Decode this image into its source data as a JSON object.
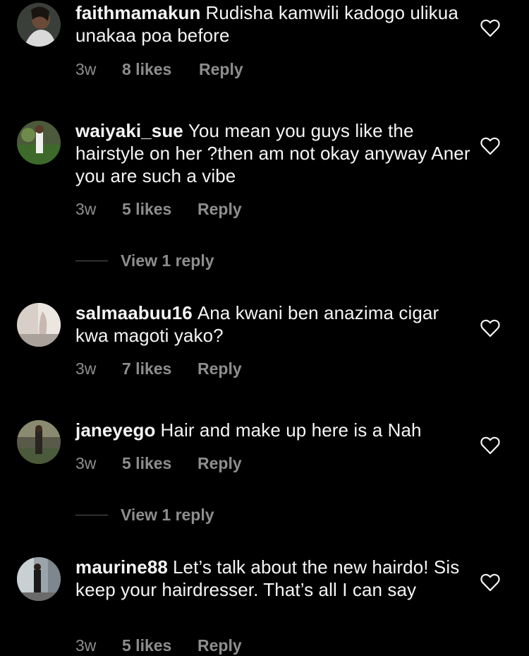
{
  "comments": [
    {
      "username": "faithmamakun",
      "text": "Rudisha kamwili kadogo ulikua unakaa poa before",
      "age": "3w",
      "likes": "8 likes",
      "reply": "Reply",
      "avatar_icon": "profile-photo"
    },
    {
      "username": "waiyaki_sue",
      "text": "You mean you guys like the hairstyle on her ?then am not okay anyway Aner you are such a vibe",
      "age": "3w",
      "likes": "5 likes",
      "reply": "Reply",
      "view_replies": "View 1 reply",
      "avatar_icon": "profile-photo"
    },
    {
      "username": "salmaabuu16",
      "text": "Ana kwani ben anazima cigar kwa magoti yako?",
      "age": "3w",
      "likes": "7 likes",
      "reply": "Reply",
      "avatar_icon": "profile-photo"
    },
    {
      "username": "janeyego",
      "text": "Hair and make up here is a Nah",
      "age": "3w",
      "likes": "5 likes",
      "reply": "Reply",
      "view_replies": "View 1 reply",
      "avatar_icon": "profile-photo"
    },
    {
      "username": "maurine88",
      "text": "Let’s talk about the new hairdo! Sis keep your hairdresser. That’s all I can say",
      "age": "3w",
      "likes": "5 likes",
      "reply": "Reply",
      "avatar_icon": "profile-photo"
    }
  ],
  "colors": {
    "background": "#000000",
    "primary_text": "#f5f5f5",
    "secondary_text": "#8e8e8e"
  },
  "icons": {
    "like": "heart-outline-icon"
  }
}
